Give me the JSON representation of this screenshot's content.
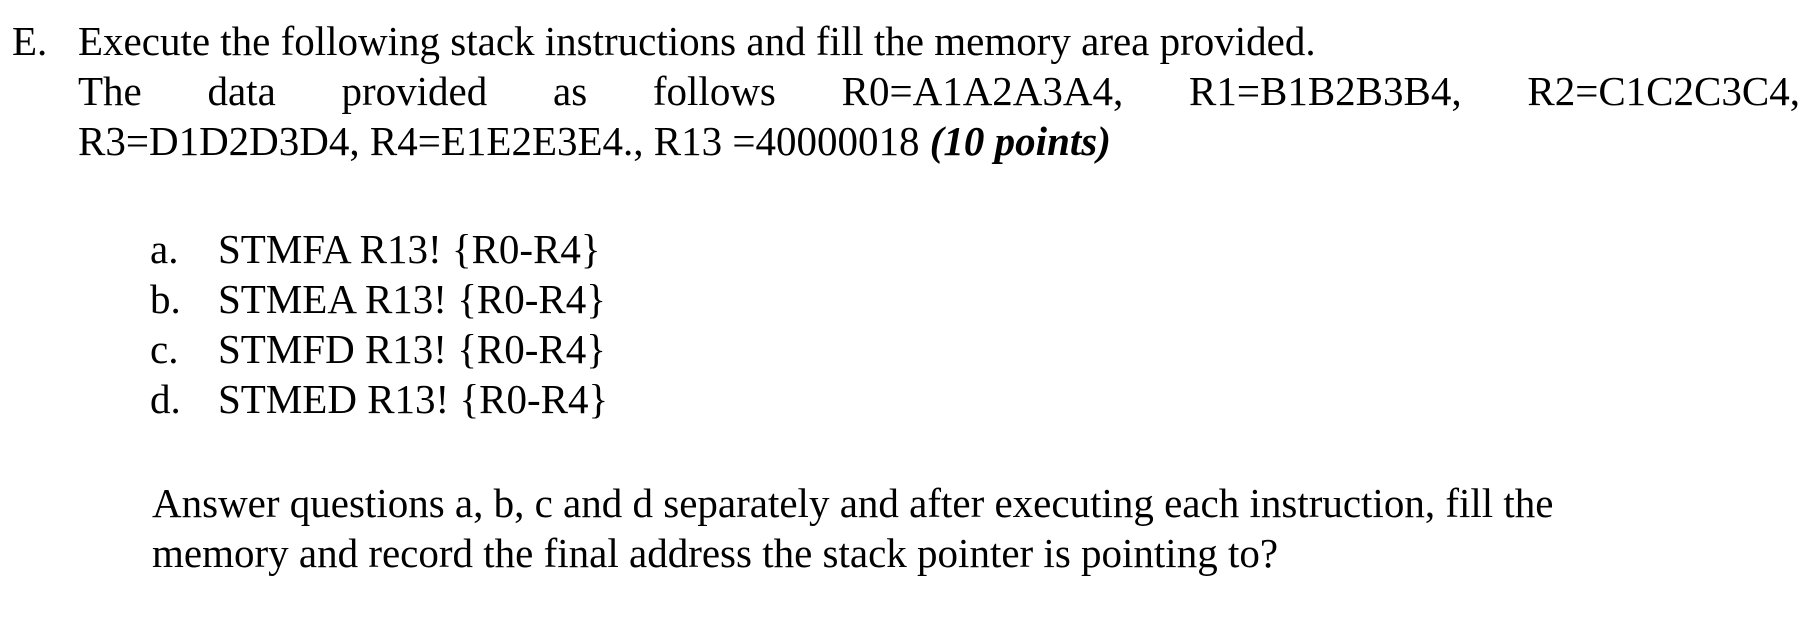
{
  "document": {
    "background_color": "#ffffff",
    "text_color": "#000000"
  },
  "question": {
    "marker": "E.",
    "prompt_line": "Execute the following stack instructions and fill the memory area provided.",
    "given_data": {
      "lead_in": "The",
      "word_2": "data",
      "word_3": "provided",
      "word_4": "as",
      "word_5": "follows",
      "register_r0": "R0=A1A2A3A4,",
      "register_r1": "R1=B1B2B3B4,",
      "register_r2": "R2=C1C2C3C4,",
      "line_2": "R3=D1D2D3D4, R4=E1E2E3E4., R13 =40000018",
      "points": "(10 points)"
    }
  },
  "instructions": {
    "items": [
      {
        "marker": "a.",
        "text": "STMFA R13! {R0-R4}"
      },
      {
        "marker": "b.",
        "text": "STMEA R13! {R0-R4}"
      },
      {
        "marker": "c.",
        "text": "STMFD R13! {R0-R4}"
      },
      {
        "marker": "d.",
        "text": "STMED R13! {R0-R4}"
      }
    ]
  },
  "closing": {
    "line_1": "Answer questions a, b, c and d separately and after executing each instruction, fill the",
    "line_2": "memory and record the final address the stack pointer is pointing to?"
  }
}
